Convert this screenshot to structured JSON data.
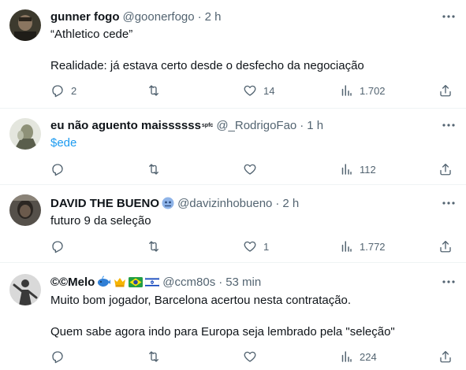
{
  "tweets": [
    {
      "name": "gunner fogo",
      "handle": "@goonerfogo",
      "time": "2 h",
      "lines": [
        "“Athletico cede”",
        "",
        "Realidade: já estava certo desde o desfecho da negociação"
      ],
      "replies": "2",
      "retweets": "",
      "likes": "14",
      "views": "1.702"
    },
    {
      "name": "eu não aguento maissssss",
      "name_sup": "spfc",
      "handle": "@_RodrigoFao",
      "time": "1 h",
      "lines": [
        "$ede"
      ],
      "replies": "",
      "retweets": "",
      "likes": "",
      "views": "112"
    },
    {
      "name": "DAVID THE BUENO",
      "handle": "@davizinhobueno",
      "time": "2 h",
      "lines": [
        "futuro 9 da seleção"
      ],
      "replies": "",
      "retweets": "",
      "likes": "1",
      "views": "1.772"
    },
    {
      "name": "©©Melo",
      "handle": "@ccm80s",
      "time": "53 min",
      "lines": [
        "Muito bom jogador, Barcelona acertou nesta contratação.",
        "",
        "Quem sabe agora indo para Europa seja lembrado pela \"seleção\""
      ],
      "replies": "",
      "retweets": "",
      "likes": "",
      "views": "224"
    }
  ],
  "separator": "·",
  "icons": {
    "reply": "reply-icon",
    "retweet": "retweet-icon",
    "like": "heart-icon",
    "views": "views-icon",
    "share": "share-icon",
    "more": "more-icon"
  },
  "colors": {
    "text": "#0f1419",
    "secondary": "#536471",
    "link": "#1d9bf0",
    "divider": "#eff3f4"
  }
}
